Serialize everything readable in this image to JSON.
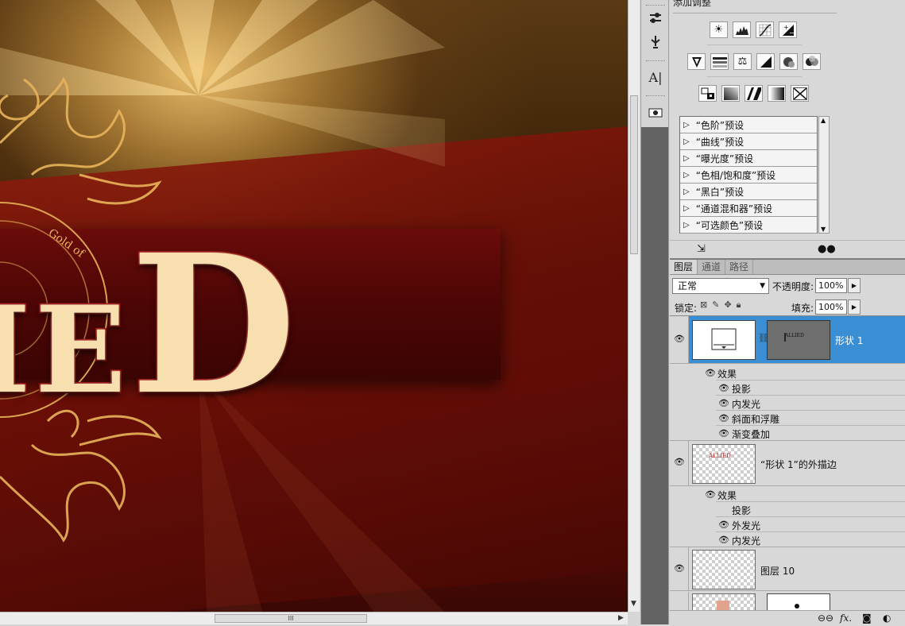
{
  "canvas": {
    "title_small_letters": "IE",
    "title_big_letter": "D",
    "ornament_text": "Gold of"
  },
  "scrollbars": {
    "h_grip": "III"
  },
  "adjustments": {
    "title": "添加调整",
    "presets": [
      "“色阶”预设",
      "“曲线”预设",
      "“曝光度”预设",
      "“色相/饱和度”预设",
      "“黑白”预设",
      "“通道混和器”预设",
      "“可选颜色”预设"
    ]
  },
  "layers_panel": {
    "tabs": [
      "图层",
      "通道",
      "路径"
    ],
    "blend_mode": "正常",
    "opacity_label": "不透明度:",
    "opacity_value": "100%",
    "lock_label": "锁定:",
    "fill_label": "填充:",
    "fill_value": "100%",
    "layers": [
      {
        "name": "形状 1",
        "selected": true,
        "effects_label": "效果",
        "effects": [
          "投影",
          "内发光",
          "斜面和浮雕",
          "渐变叠加"
        ]
      },
      {
        "name": "“形状 1”的外描边",
        "selected": false,
        "effects_label": "效果",
        "effects": [
          "投影",
          "外发光",
          "内发光"
        ]
      },
      {
        "name": "图层 10",
        "selected": false
      }
    ],
    "bottom_icons": [
      "link-icon",
      "fx-icon",
      "mask-icon",
      "adjustment-layer-icon"
    ],
    "fx_label": "fx."
  }
}
